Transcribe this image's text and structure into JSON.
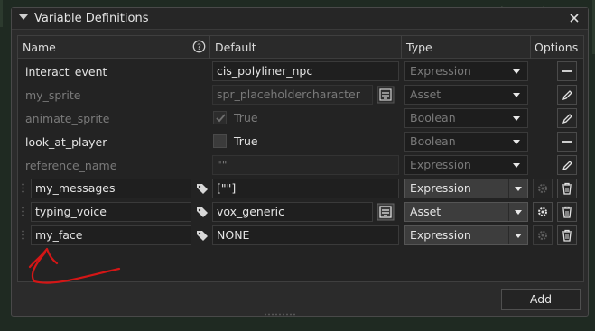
{
  "window": {
    "title": "Variable Definitions"
  },
  "columns": {
    "name": "Name",
    "default": "Default",
    "type": "Type",
    "options": "Options"
  },
  "rows": [
    {
      "name": "interact_event",
      "default": "cis_polyliner_npc",
      "type": "Expression",
      "option": "minus-icon",
      "state": "editable-inherited"
    },
    {
      "name": "my_sprite",
      "default": "spr_placeholdercharacter",
      "type": "Asset",
      "option": "pencil-icon",
      "state": "inherited"
    },
    {
      "name": "animate_sprite",
      "default": "True",
      "type": "Boolean",
      "option": "pencil-icon",
      "state": "inherited"
    },
    {
      "name": "look_at_player",
      "default": "True",
      "type": "Boolean",
      "option": "minus-icon",
      "state": "editable-inherited"
    },
    {
      "name": "reference_name",
      "default": "\"\"",
      "type": "Expression",
      "option": "pencil-icon",
      "state": "inherited"
    },
    {
      "name": "my_messages",
      "default": "[\"\"]",
      "type": "Expression",
      "option": "gear-icon",
      "state": "own"
    },
    {
      "name": "typing_voice",
      "default": "vox_generic",
      "type": "Asset",
      "option": "gear-icon",
      "state": "own"
    },
    {
      "name": "my_face",
      "default": "NONE",
      "type": "Expression",
      "option": "gear-icon",
      "state": "own"
    }
  ],
  "buttons": {
    "add": "Add"
  },
  "colors": {
    "annotation": "#d41616",
    "panel": "#2b2b2b",
    "field": "#1f1f1f"
  }
}
